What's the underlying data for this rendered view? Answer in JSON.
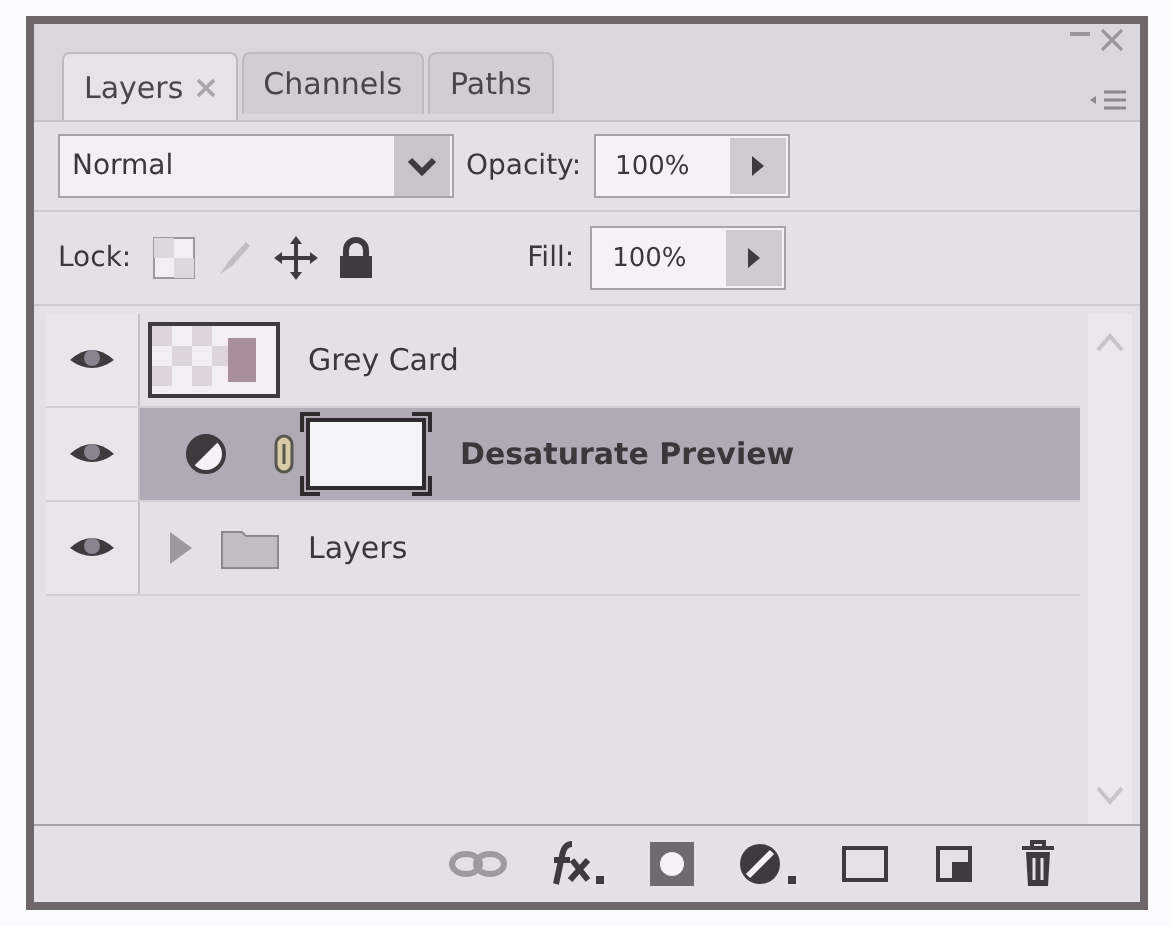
{
  "tabs": [
    {
      "label": "Layers",
      "selected": true
    },
    {
      "label": "Channels",
      "selected": false
    },
    {
      "label": "Paths",
      "selected": false
    }
  ],
  "blend_mode": {
    "value": "Normal"
  },
  "opacity": {
    "label": "Opacity:",
    "value": "100%"
  },
  "lock": {
    "label": "Lock:"
  },
  "fill": {
    "label": "Fill:",
    "value": "100%"
  },
  "layers": [
    {
      "kind": "layer",
      "name": "Grey Card",
      "visible": true,
      "selected": false
    },
    {
      "kind": "adjustment",
      "name": "Desaturate Preview",
      "visible": true,
      "selected": true
    },
    {
      "kind": "group",
      "name": "Layers",
      "visible": true,
      "selected": false,
      "expanded": false
    }
  ]
}
